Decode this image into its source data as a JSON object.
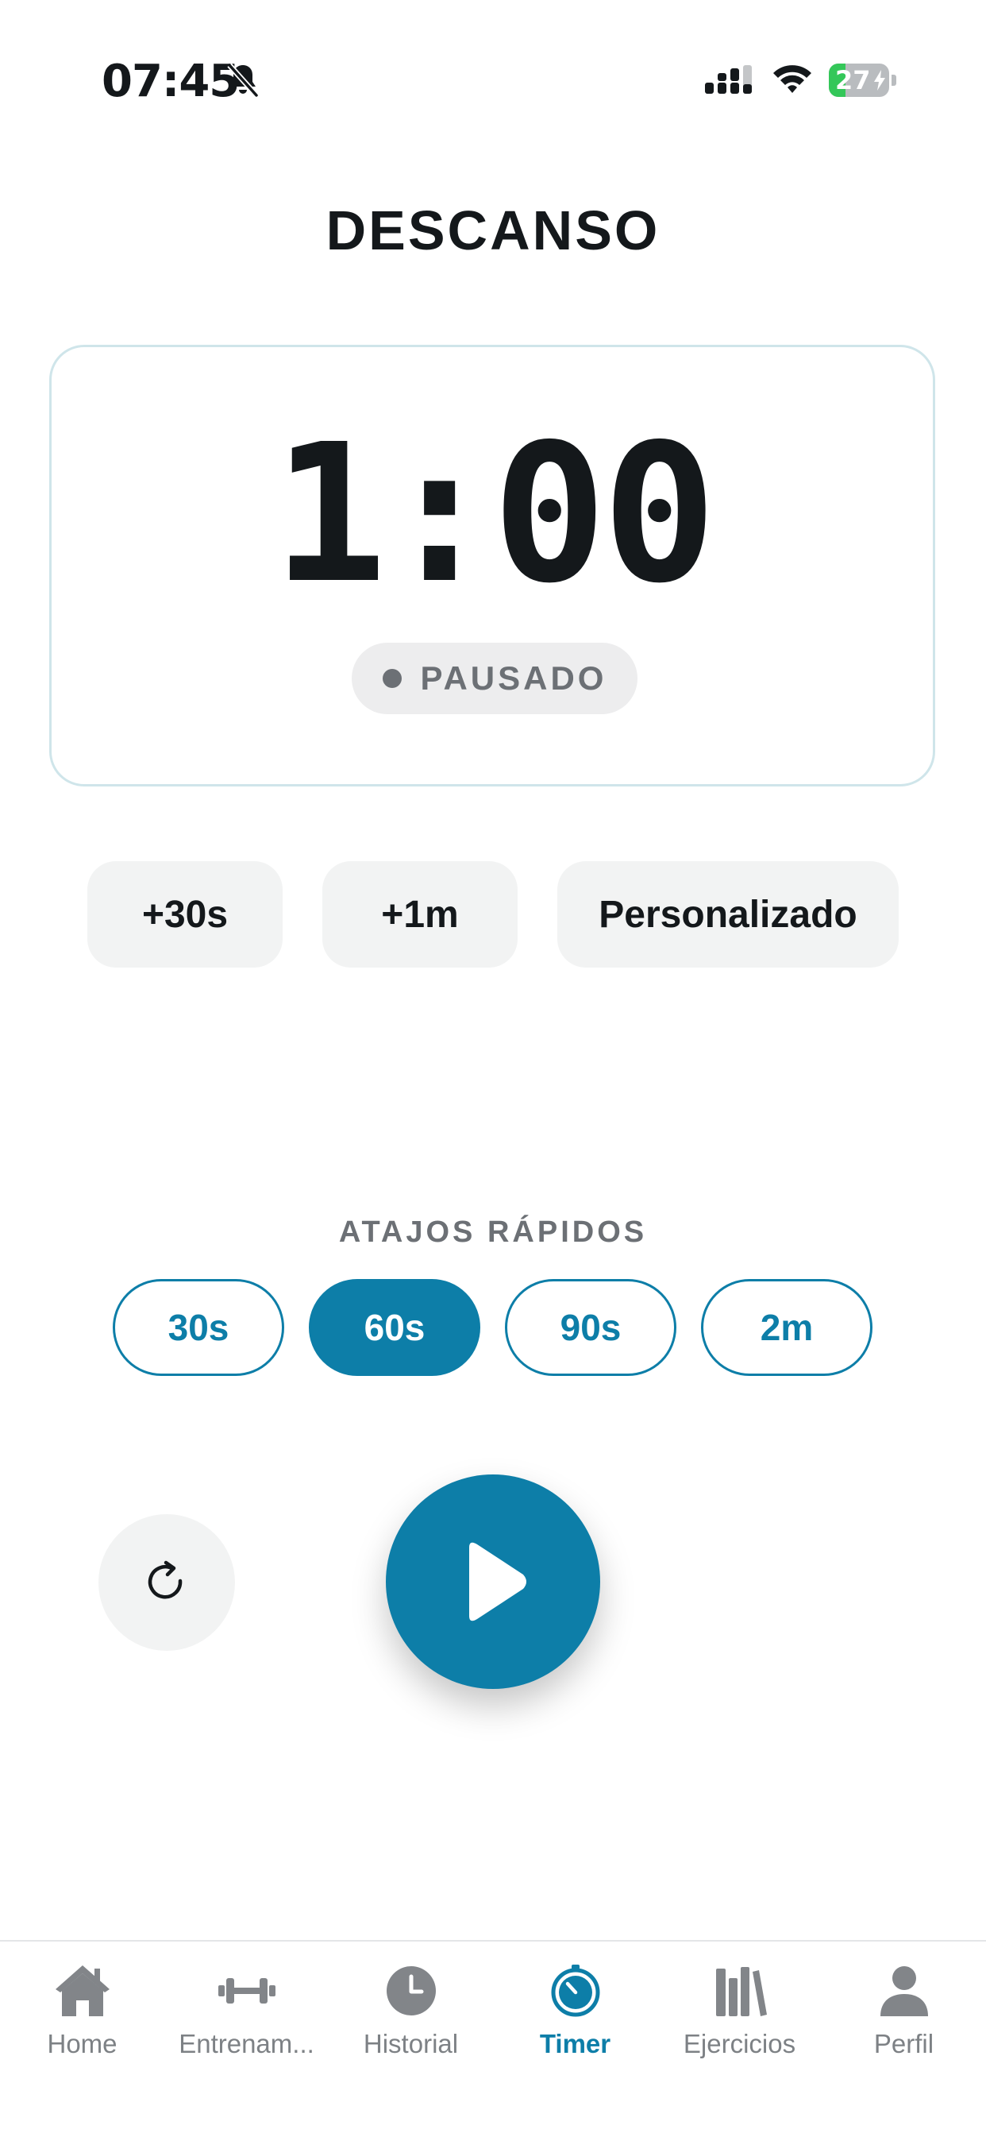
{
  "status_bar": {
    "time": "07:45",
    "battery_level": "27",
    "battery_fraction": 0.27,
    "icons": [
      "bell-slash-icon",
      "cellular-signal-icon",
      "wifi-icon",
      "battery-charging-icon"
    ]
  },
  "header": {
    "title": "DESCANSO"
  },
  "timer": {
    "display": "1:00",
    "status": "PAUSADO"
  },
  "adjust_buttons": {
    "add_30s": "+30s",
    "add_1m": "+1m",
    "custom": "Personalizado"
  },
  "shortcuts": {
    "title": "ATAJOS RÁPIDOS",
    "items": [
      {
        "label": "30s",
        "selected": false
      },
      {
        "label": "60s",
        "selected": true
      },
      {
        "label": "90s",
        "selected": false
      },
      {
        "label": "2m",
        "selected": false
      }
    ]
  },
  "controls": {
    "reset_icon": "reset-icon",
    "play_icon": "play-icon"
  },
  "nav": {
    "items": [
      {
        "label": "Home",
        "icon": "home-icon",
        "active": false
      },
      {
        "label": "Entrenam...",
        "icon": "dumbbell-icon",
        "active": false
      },
      {
        "label": "Historial",
        "icon": "clock-icon",
        "active": false
      },
      {
        "label": "Timer",
        "icon": "timer-icon",
        "active": true
      },
      {
        "label": "Ejercicios",
        "icon": "library-icon",
        "active": false
      },
      {
        "label": "Perfil",
        "icon": "person-icon",
        "active": false
      }
    ]
  },
  "colors": {
    "accent": "#0d7ea8",
    "text": "#14181b",
    "muted": "#6c7075",
    "card_border": "#cfe5ea",
    "button_bg": "#f2f3f3",
    "battery_green": "#34c759"
  }
}
